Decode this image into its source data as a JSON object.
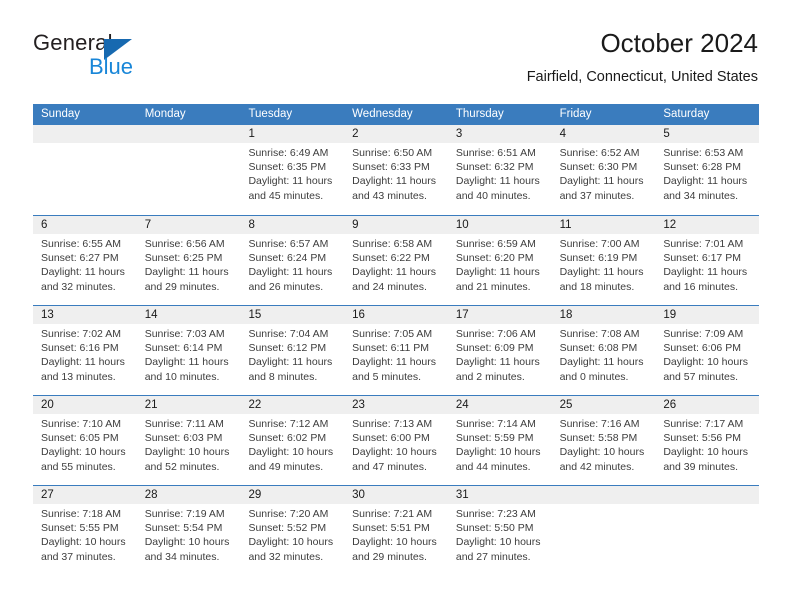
{
  "brand": {
    "name_top": "General",
    "name_bottom": "Blue",
    "triangle_color": "#1769b0",
    "blue_color": "#1886d8"
  },
  "header": {
    "title": "October 2024",
    "subtitle": "Fairfield, Connecticut, United States"
  },
  "theme": {
    "header_blue": "#3a7cbe",
    "day_band_gray": "#efefef",
    "text": "#3d3d3d"
  },
  "weekdays": [
    "Sunday",
    "Monday",
    "Tuesday",
    "Wednesday",
    "Thursday",
    "Friday",
    "Saturday"
  ],
  "weeks": [
    [
      {
        "date": "",
        "sunrise": "",
        "sunset": "",
        "daylight": "",
        "empty": true
      },
      {
        "date": "",
        "sunrise": "",
        "sunset": "",
        "daylight": "",
        "empty": true
      },
      {
        "date": "1",
        "sunrise": "Sunrise: 6:49 AM",
        "sunset": "Sunset: 6:35 PM",
        "daylight": "Daylight: 11 hours and 45 minutes."
      },
      {
        "date": "2",
        "sunrise": "Sunrise: 6:50 AM",
        "sunset": "Sunset: 6:33 PM",
        "daylight": "Daylight: 11 hours and 43 minutes."
      },
      {
        "date": "3",
        "sunrise": "Sunrise: 6:51 AM",
        "sunset": "Sunset: 6:32 PM",
        "daylight": "Daylight: 11 hours and 40 minutes."
      },
      {
        "date": "4",
        "sunrise": "Sunrise: 6:52 AM",
        "sunset": "Sunset: 6:30 PM",
        "daylight": "Daylight: 11 hours and 37 minutes."
      },
      {
        "date": "5",
        "sunrise": "Sunrise: 6:53 AM",
        "sunset": "Sunset: 6:28 PM",
        "daylight": "Daylight: 11 hours and 34 minutes."
      }
    ],
    [
      {
        "date": "6",
        "sunrise": "Sunrise: 6:55 AM",
        "sunset": "Sunset: 6:27 PM",
        "daylight": "Daylight: 11 hours and 32 minutes."
      },
      {
        "date": "7",
        "sunrise": "Sunrise: 6:56 AM",
        "sunset": "Sunset: 6:25 PM",
        "daylight": "Daylight: 11 hours and 29 minutes."
      },
      {
        "date": "8",
        "sunrise": "Sunrise: 6:57 AM",
        "sunset": "Sunset: 6:24 PM",
        "daylight": "Daylight: 11 hours and 26 minutes."
      },
      {
        "date": "9",
        "sunrise": "Sunrise: 6:58 AM",
        "sunset": "Sunset: 6:22 PM",
        "daylight": "Daylight: 11 hours and 24 minutes."
      },
      {
        "date": "10",
        "sunrise": "Sunrise: 6:59 AM",
        "sunset": "Sunset: 6:20 PM",
        "daylight": "Daylight: 11 hours and 21 minutes."
      },
      {
        "date": "11",
        "sunrise": "Sunrise: 7:00 AM",
        "sunset": "Sunset: 6:19 PM",
        "daylight": "Daylight: 11 hours and 18 minutes."
      },
      {
        "date": "12",
        "sunrise": "Sunrise: 7:01 AM",
        "sunset": "Sunset: 6:17 PM",
        "daylight": "Daylight: 11 hours and 16 minutes."
      }
    ],
    [
      {
        "date": "13",
        "sunrise": "Sunrise: 7:02 AM",
        "sunset": "Sunset: 6:16 PM",
        "daylight": "Daylight: 11 hours and 13 minutes."
      },
      {
        "date": "14",
        "sunrise": "Sunrise: 7:03 AM",
        "sunset": "Sunset: 6:14 PM",
        "daylight": "Daylight: 11 hours and 10 minutes."
      },
      {
        "date": "15",
        "sunrise": "Sunrise: 7:04 AM",
        "sunset": "Sunset: 6:12 PM",
        "daylight": "Daylight: 11 hours and 8 minutes."
      },
      {
        "date": "16",
        "sunrise": "Sunrise: 7:05 AM",
        "sunset": "Sunset: 6:11 PM",
        "daylight": "Daylight: 11 hours and 5 minutes."
      },
      {
        "date": "17",
        "sunrise": "Sunrise: 7:06 AM",
        "sunset": "Sunset: 6:09 PM",
        "daylight": "Daylight: 11 hours and 2 minutes."
      },
      {
        "date": "18",
        "sunrise": "Sunrise: 7:08 AM",
        "sunset": "Sunset: 6:08 PM",
        "daylight": "Daylight: 11 hours and 0 minutes."
      },
      {
        "date": "19",
        "sunrise": "Sunrise: 7:09 AM",
        "sunset": "Sunset: 6:06 PM",
        "daylight": "Daylight: 10 hours and 57 minutes."
      }
    ],
    [
      {
        "date": "20",
        "sunrise": "Sunrise: 7:10 AM",
        "sunset": "Sunset: 6:05 PM",
        "daylight": "Daylight: 10 hours and 55 minutes."
      },
      {
        "date": "21",
        "sunrise": "Sunrise: 7:11 AM",
        "sunset": "Sunset: 6:03 PM",
        "daylight": "Daylight: 10 hours and 52 minutes."
      },
      {
        "date": "22",
        "sunrise": "Sunrise: 7:12 AM",
        "sunset": "Sunset: 6:02 PM",
        "daylight": "Daylight: 10 hours and 49 minutes."
      },
      {
        "date": "23",
        "sunrise": "Sunrise: 7:13 AM",
        "sunset": "Sunset: 6:00 PM",
        "daylight": "Daylight: 10 hours and 47 minutes."
      },
      {
        "date": "24",
        "sunrise": "Sunrise: 7:14 AM",
        "sunset": "Sunset: 5:59 PM",
        "daylight": "Daylight: 10 hours and 44 minutes."
      },
      {
        "date": "25",
        "sunrise": "Sunrise: 7:16 AM",
        "sunset": "Sunset: 5:58 PM",
        "daylight": "Daylight: 10 hours and 42 minutes."
      },
      {
        "date": "26",
        "sunrise": "Sunrise: 7:17 AM",
        "sunset": "Sunset: 5:56 PM",
        "daylight": "Daylight: 10 hours and 39 minutes."
      }
    ],
    [
      {
        "date": "27",
        "sunrise": "Sunrise: 7:18 AM",
        "sunset": "Sunset: 5:55 PM",
        "daylight": "Daylight: 10 hours and 37 minutes."
      },
      {
        "date": "28",
        "sunrise": "Sunrise: 7:19 AM",
        "sunset": "Sunset: 5:54 PM",
        "daylight": "Daylight: 10 hours and 34 minutes."
      },
      {
        "date": "29",
        "sunrise": "Sunrise: 7:20 AM",
        "sunset": "Sunset: 5:52 PM",
        "daylight": "Daylight: 10 hours and 32 minutes."
      },
      {
        "date": "30",
        "sunrise": "Sunrise: 7:21 AM",
        "sunset": "Sunset: 5:51 PM",
        "daylight": "Daylight: 10 hours and 29 minutes."
      },
      {
        "date": "31",
        "sunrise": "Sunrise: 7:23 AM",
        "sunset": "Sunset: 5:50 PM",
        "daylight": "Daylight: 10 hours and 27 minutes."
      },
      {
        "date": "",
        "sunrise": "",
        "sunset": "",
        "daylight": "",
        "empty": true
      },
      {
        "date": "",
        "sunrise": "",
        "sunset": "",
        "daylight": "",
        "empty": true
      }
    ]
  ]
}
